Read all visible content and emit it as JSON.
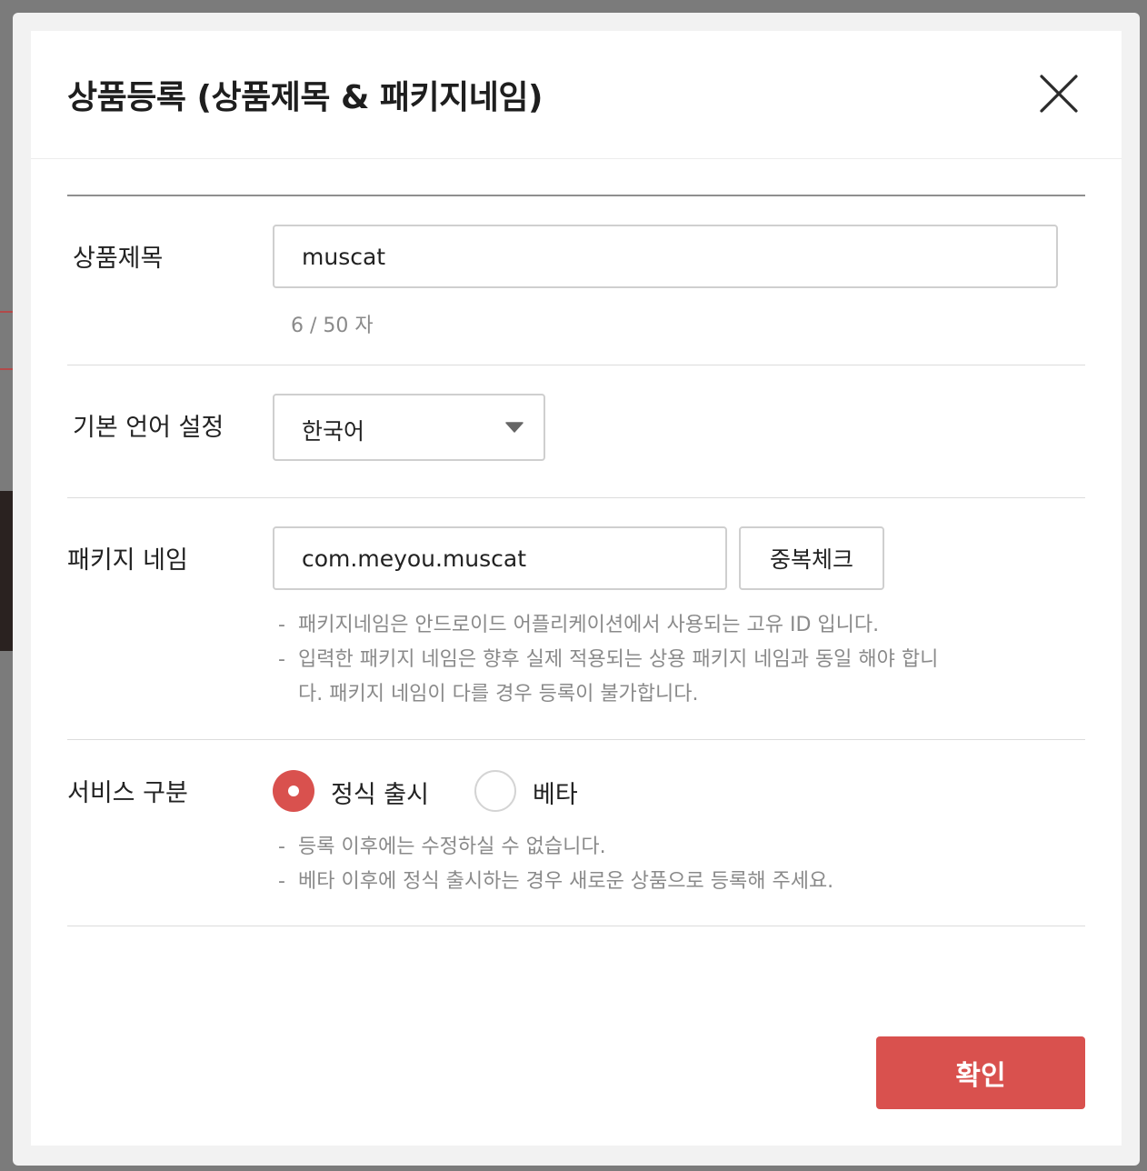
{
  "modal": {
    "title": "상품등록 (상품제목 & 패키지네임)",
    "close_icon": "close-icon"
  },
  "product_title": {
    "label": "상품제목",
    "value": "muscat",
    "counter": "6 / 50 자"
  },
  "default_language": {
    "label": "기본 언어 설정",
    "selected": "한국어",
    "caret_icon": "caret-down-icon"
  },
  "package_name": {
    "label": "패키지 네임",
    "value": "com.meyou.muscat",
    "check_button": "중복체크",
    "notes": [
      "패키지네임은 안드로이드 어플리케이션에서 사용되는 고유 ID 입니다.",
      "입력한 패키지 네임은 향후 실제 적용되는 상용 패키지 네임과 동일 해야 합니",
      "다. 패키지 네임이 다를 경우 등록이 불가합니다."
    ]
  },
  "service_type": {
    "label": "서비스 구분",
    "options": [
      {
        "label": "정식 출시",
        "selected": true
      },
      {
        "label": "베타",
        "selected": false
      }
    ],
    "notes": [
      "등록 이후에는 수정하실 수 없습니다.",
      "베타 이후에 정식 출시하는 경우 새로운 상품으로 등록해 주세요."
    ]
  },
  "footer": {
    "confirm_button": "확인"
  },
  "colors": {
    "accent": "#d9514e",
    "overlay": "#7b7b7b",
    "muted_text": "#8a8a8a"
  }
}
